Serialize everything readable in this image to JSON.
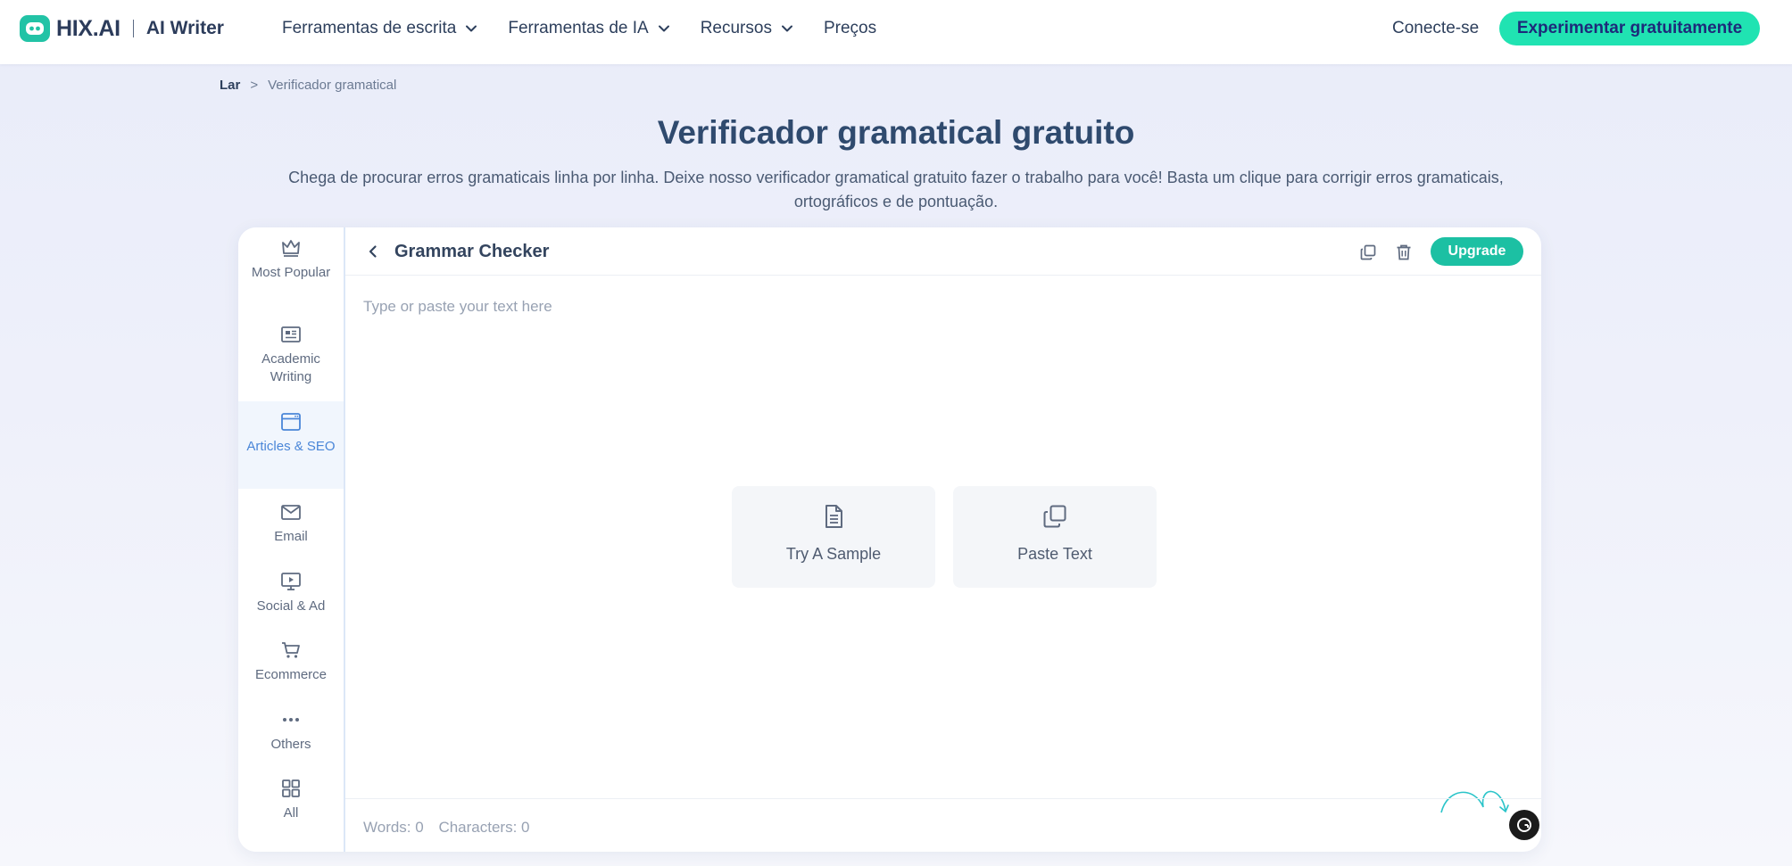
{
  "header": {
    "brand_name": "HIX.AI",
    "product_name": "AI Writer",
    "nav": [
      {
        "label": "Ferramentas de escrita"
      },
      {
        "label": "Ferramentas de IA"
      },
      {
        "label": "Recursos"
      },
      {
        "label": "Preços"
      }
    ],
    "login_label": "Conecte-se",
    "cta_label": "Experimentar gratuitamente"
  },
  "breadcrumb": {
    "home": "Lar",
    "separator": ">",
    "current": "Verificador gramatical"
  },
  "page": {
    "title": "Verificador gramatical gratuito",
    "subtitle": "Chega de procurar erros gramaticais linha por linha. Deixe nosso verificador gramatical gratuito fazer o trabalho para você! Basta um clique para corrigir erros gramaticais, ortográficos e de pontuação."
  },
  "sidebar": {
    "items": [
      {
        "label": "Most Popular",
        "icon": "crown-icon",
        "active": false
      },
      {
        "label": "Academic Writing",
        "icon": "newspaper-icon",
        "active": false
      },
      {
        "label": "Articles & SEO",
        "icon": "browser-window-icon",
        "active": true
      },
      {
        "label": "Email",
        "icon": "envelope-icon",
        "active": false
      },
      {
        "label": "Social & Ad",
        "icon": "monitor-play-icon",
        "active": false
      },
      {
        "label": "Ecommerce",
        "icon": "cart-icon",
        "active": false
      },
      {
        "label": "Others",
        "icon": "dots-icon",
        "active": false
      },
      {
        "label": "All",
        "icon": "grid-icon",
        "active": false
      }
    ]
  },
  "tool": {
    "title": "Grammar Checker",
    "upgrade_label": "Upgrade",
    "editor_placeholder": "Type or paste your text here",
    "editor_value": "",
    "actions": [
      {
        "label": "Try A Sample",
        "icon": "document-icon"
      },
      {
        "label": "Paste Text",
        "icon": "copy-icon"
      }
    ],
    "words_label": "Words: 0",
    "characters_label": "Characters: 0"
  },
  "colors": {
    "accent": "#20e3b2",
    "upgrade": "#1cc0a3",
    "active_sidebar": "#4a86d8",
    "title": "#2f4a6e"
  }
}
